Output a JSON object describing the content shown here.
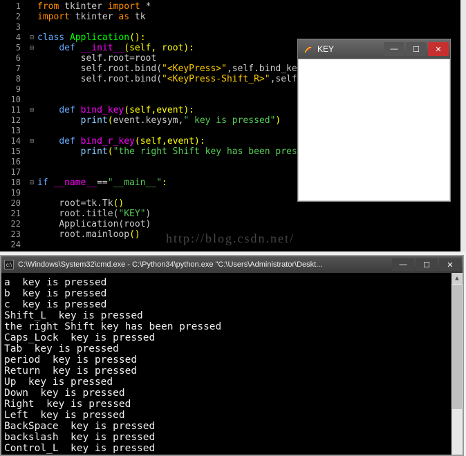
{
  "editor": {
    "lines": [
      1,
      2,
      3,
      4,
      5,
      6,
      7,
      8,
      9,
      10,
      11,
      12,
      13,
      14,
      15,
      16,
      17,
      18,
      19,
      20,
      21,
      22,
      23,
      24
    ]
  },
  "code": {
    "l1": {
      "from": "from ",
      "tkinter": "tkinter ",
      "import": "import ",
      "star": "*"
    },
    "l2": {
      "import": "import ",
      "tkinter": "tkinter ",
      "as": "as ",
      "tk": "tk"
    },
    "l4": {
      "class_": "class ",
      "app": "Application",
      "paren": "():"
    },
    "l5": {
      "def_": "def ",
      "init": "__init__",
      "args": "(self, root):"
    },
    "l6": {
      "body": "self.root=root"
    },
    "l7": {
      "a": "self.root.bind(",
      "s": "\"<KeyPress>\"",
      "b": ",self.bind_key)"
    },
    "l8": {
      "a": "self.root.bind(",
      "s": "\"<KeyPress-Shift_R>\"",
      "b": ",self.bind_r_key)"
    },
    "l11": {
      "def_": "def ",
      "fn": "bind_key",
      "args": "(self,event):"
    },
    "l12": {
      "print_": "print",
      "open": "(",
      "a": "event.keysym,",
      "s": "\" key is pressed\"",
      "close": ")"
    },
    "l14": {
      "def_": "def ",
      "fn": "bind_r_key",
      "args": "(self,event):"
    },
    "l15": {
      "print_": "print",
      "open": "(",
      "s": "\"the right Shift key has been pressed\"",
      "close": ")"
    },
    "l18": {
      "if_": "if ",
      "name": "__name__",
      "eq": "==",
      "s": "\"__main__\"",
      "colon": ":"
    },
    "l20": {
      "a": "root=tk.Tk",
      "p": "()"
    },
    "l21": {
      "a": "root.title(",
      "s": "\"KEY\"",
      "b": ")"
    },
    "l22": {
      "a": "Application(root)"
    },
    "l23": {
      "a": "root.mainloop",
      "p": "()"
    }
  },
  "tkwin": {
    "title": "KEY"
  },
  "watermark": "http://blog.csdn.net/",
  "console": {
    "title": "C:\\Windows\\System32\\cmd.exe - C:\\Python34\\python.exe  \"C:\\Users\\Administrator\\Deskt...",
    "out": [
      "a  key is pressed",
      "b  key is pressed",
      "c  key is pressed",
      "Shift_L  key is pressed",
      "the right Shift key has been pressed",
      "Caps_Lock  key is pressed",
      "Tab  key is pressed",
      "period  key is pressed",
      "Return  key is pressed",
      "Up  key is pressed",
      "Down  key is pressed",
      "Right  key is pressed",
      "Left  key is pressed",
      "BackSpace  key is pressed",
      "backslash  key is pressed",
      "Control_L  key is pressed"
    ]
  }
}
